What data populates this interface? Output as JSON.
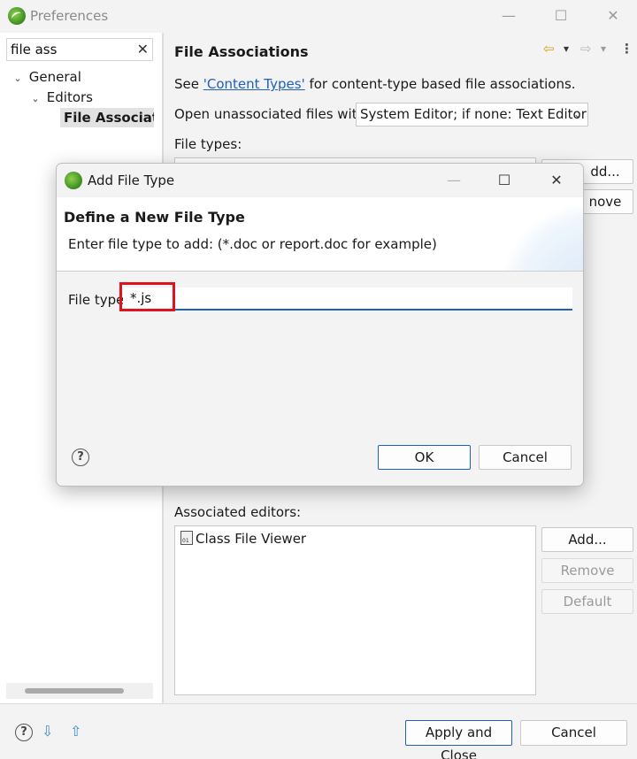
{
  "window": {
    "title": "Preferences",
    "minimize": "—",
    "maximize": "☐",
    "close": "✕"
  },
  "sidebar": {
    "search_value": "file ass",
    "clear_glyph": "✕",
    "tree": [
      {
        "label": "General",
        "chevron": "⌄"
      },
      {
        "label": "Editors",
        "chevron": "⌄"
      },
      {
        "label": "File Associatio"
      }
    ]
  },
  "page": {
    "title": "File Associations",
    "back_glyph": "⇦",
    "forward_glyph": "⇨",
    "menu_glyph": "▾",
    "see_prefix": "See ",
    "content_types_link": "'Content Types'",
    "see_suffix": " for content-type based file associations.",
    "open_unassoc_label": "Open unassociated files with:",
    "open_unassoc_value": "System Editor; if none: Text Editor",
    "dropdown_glyph": "⌄",
    "file_types_label": "File types:",
    "file_types_add_partial": "dd...",
    "file_types_remove_partial": "nove",
    "associated_editors_label": "Associated editors:",
    "associated_editors": [
      "Class File Viewer"
    ],
    "editors_add": "Add...",
    "editors_remove": "Remove",
    "editors_default": "Default"
  },
  "footer": {
    "help_glyph": "?",
    "import_glyph": "⇩",
    "export_glyph": "⇧",
    "apply_close": "Apply and Close",
    "cancel": "Cancel"
  },
  "dialog": {
    "title": "Add File Type",
    "minimize": "—",
    "maximize": "☐",
    "close": "✕",
    "heading": "Define a New File Type",
    "description": "Enter file type to add: (*.doc or report.doc for example)",
    "file_type_label": "File type:",
    "file_type_value": "*.js",
    "help_glyph": "?",
    "ok": "OK",
    "cancel": "Cancel"
  },
  "colors": {
    "accent": "#1f5fbf",
    "highlight": "#e0121c"
  }
}
